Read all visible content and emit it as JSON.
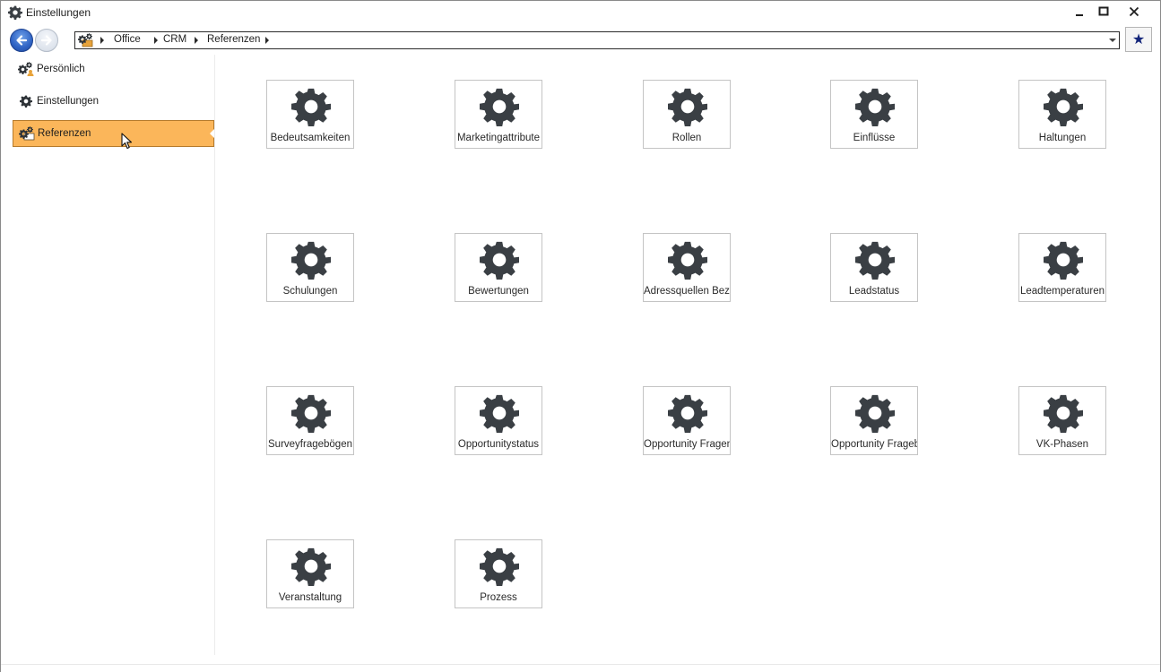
{
  "window": {
    "title": "Einstellungen",
    "icon": "gear-icon",
    "controls": [
      "minimize-icon",
      "maximize-icon",
      "close-icon"
    ]
  },
  "navigation": {
    "back_icon": "arrow-left-icon",
    "forward_icon": "arrow-right-icon",
    "address_icon": "settings-folder-icon",
    "breadcrumb": [
      "Office",
      "CRM",
      "Referenzen"
    ],
    "favorite_icon": "star-icon"
  },
  "sidebar": {
    "items": [
      {
        "label": "Persönlich",
        "icon": "user-settings-icon",
        "selected": false
      },
      {
        "label": "Einstellungen",
        "icon": "gear-icon",
        "selected": false
      },
      {
        "label": "Referenzen",
        "icon": "settings-folder-icon",
        "selected": true
      }
    ]
  },
  "tiles": [
    {
      "label": "Bedeutsamkeiten",
      "icon": "gear-icon"
    },
    {
      "label": "Marketingattribute",
      "icon": "gear-icon"
    },
    {
      "label": "Rollen",
      "icon": "gear-icon"
    },
    {
      "label": "Einflüsse",
      "icon": "gear-icon"
    },
    {
      "label": "Haltungen",
      "icon": "gear-icon"
    },
    {
      "label": "Schulungen",
      "icon": "gear-icon"
    },
    {
      "label": "Bewertungen",
      "icon": "gear-icon"
    },
    {
      "label": "Adressquellen Beze",
      "icon": "gear-icon"
    },
    {
      "label": "Leadstatus",
      "icon": "gear-icon"
    },
    {
      "label": "Leadtemperaturen",
      "icon": "gear-icon"
    },
    {
      "label": "Surveyfragebögen",
      "icon": "gear-icon"
    },
    {
      "label": "Opportunitystatus",
      "icon": "gear-icon"
    },
    {
      "label": "Opportunity Fragen",
      "icon": "gear-icon"
    },
    {
      "label": "Opportunity Frageb",
      "icon": "gear-icon"
    },
    {
      "label": "VK-Phasen",
      "icon": "gear-icon"
    },
    {
      "label": "Veranstaltung",
      "icon": "gear-icon"
    },
    {
      "label": "Prozess",
      "icon": "gear-icon"
    }
  ],
  "colors": {
    "selected_bg": "#fbb65a",
    "gear": "#3a3f44",
    "favorite_star": "#14267a"
  }
}
